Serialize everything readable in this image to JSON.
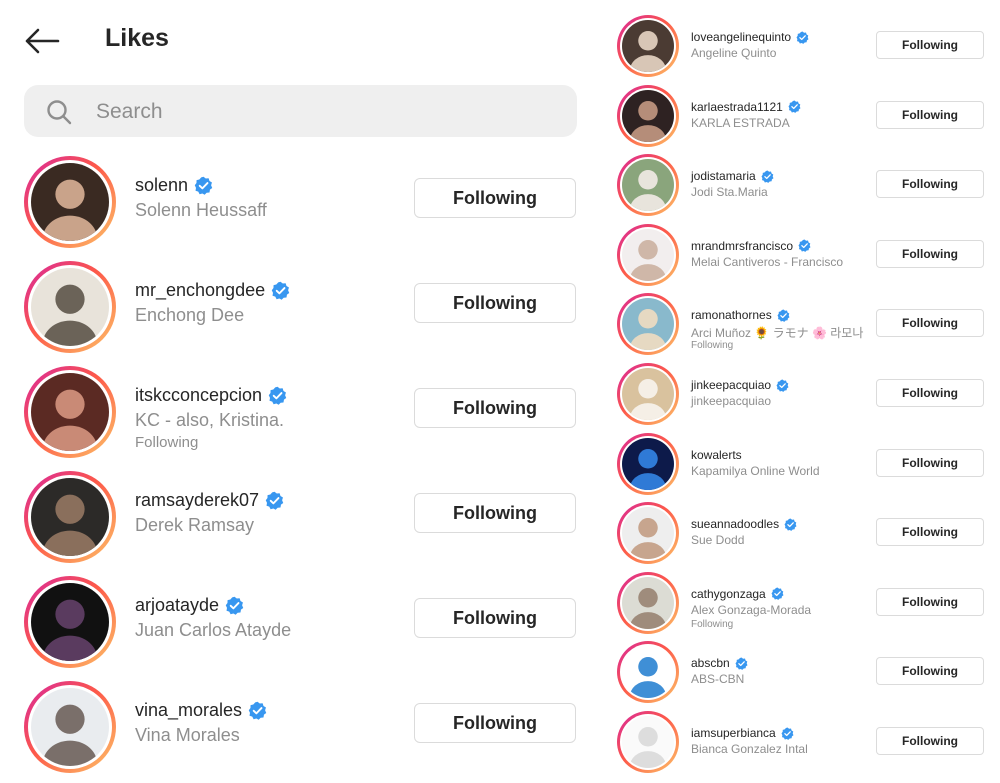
{
  "header": {
    "title": "Likes"
  },
  "search": {
    "placeholder": "Search"
  },
  "colors": {
    "verified": "#3897f0",
    "ring_start": "#d6249f",
    "ring_end": "#fdc468"
  },
  "left_list": [
    {
      "username": "solenn",
      "full_name": "Solenn Heussaff",
      "following_tag": "",
      "button": "Following",
      "verified": true
    },
    {
      "username": "mr_enchongdee",
      "full_name": "Enchong Dee",
      "following_tag": "",
      "button": "Following",
      "verified": true
    },
    {
      "username": "itskcconcepcion",
      "full_name": "KC - also, Kristina.",
      "following_tag": "Following",
      "button": "Following",
      "verified": true
    },
    {
      "username": "ramsayderek07",
      "full_name": "Derek Ramsay",
      "following_tag": "",
      "button": "Following",
      "verified": true
    },
    {
      "username": "arjoatayde",
      "full_name": "Juan Carlos Atayde",
      "following_tag": "",
      "button": "Following",
      "verified": true
    },
    {
      "username": "vina_morales",
      "full_name": "Vina Morales",
      "following_tag": "",
      "button": "Following",
      "verified": true
    }
  ],
  "right_list": [
    {
      "username": "loveangelinequinto",
      "full_name": "Angeline Quinto",
      "following_tag": "",
      "button": "Following",
      "verified": true
    },
    {
      "username": "karlaestrada1121",
      "full_name": "KARLA ESTRADA",
      "following_tag": "",
      "button": "Following",
      "verified": true
    },
    {
      "username": "jodistamaria",
      "full_name": "Jodi Sta.Maria",
      "following_tag": "",
      "button": "Following",
      "verified": true
    },
    {
      "username": "mrandmrsfrancisco",
      "full_name": "Melai Cantiveros - Francisco",
      "following_tag": "",
      "button": "Following",
      "verified": true
    },
    {
      "username": "ramonathornes",
      "full_name": "Arci Muñoz 🌻 ラモナ 🌸 라모나",
      "following_tag": "Following",
      "button": "Following",
      "verified": true
    },
    {
      "username": "jinkeepacquiao",
      "full_name": "jinkeepacquiao",
      "following_tag": "",
      "button": "Following",
      "verified": true
    },
    {
      "username": "kowalerts",
      "full_name": "Kapamilya Online World",
      "following_tag": "",
      "button": "Following",
      "verified": false
    },
    {
      "username": "sueannadoodles",
      "full_name": "Sue Dodd",
      "following_tag": "",
      "button": "Following",
      "verified": true
    },
    {
      "username": "cathygonzaga",
      "full_name": "Alex Gonzaga-Morada",
      "following_tag": "Following",
      "button": "Following",
      "verified": true
    },
    {
      "username": "abscbn",
      "full_name": "ABS-CBN",
      "following_tag": "",
      "button": "Following",
      "verified": true
    },
    {
      "username": "iamsuperbianca",
      "full_name": "Bianca Gonzalez Intal",
      "following_tag": "",
      "button": "Following",
      "verified": true
    }
  ]
}
